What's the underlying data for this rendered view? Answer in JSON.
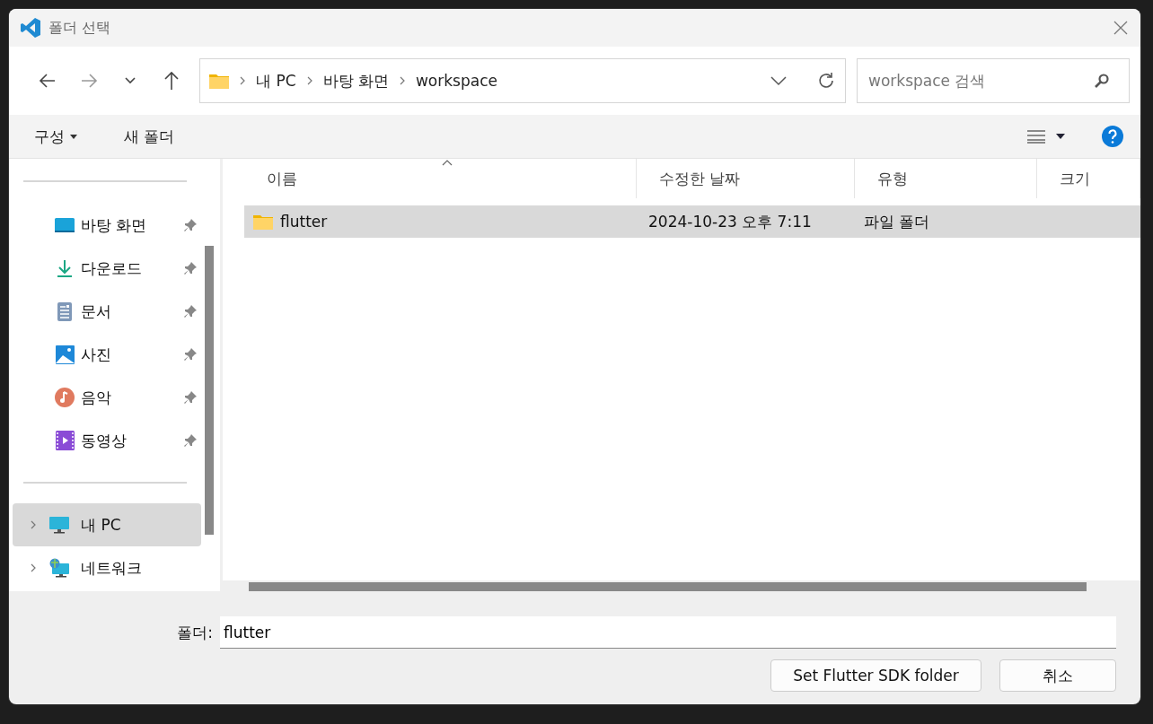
{
  "window": {
    "title": "폴더 선택"
  },
  "address_bar": {
    "crumbs": [
      "내 PC",
      "바탕 화면",
      "workspace"
    ]
  },
  "search": {
    "placeholder": "workspace 검색"
  },
  "toolbar": {
    "organize": "구성",
    "new_folder": "새 폴더"
  },
  "sidebar": {
    "quick_access": [
      {
        "label": "바탕 화면",
        "kind": "desktop"
      },
      {
        "label": "다운로드",
        "kind": "download"
      },
      {
        "label": "문서",
        "kind": "document"
      },
      {
        "label": "사진",
        "kind": "picture"
      },
      {
        "label": "음악",
        "kind": "music"
      },
      {
        "label": "동영상",
        "kind": "video"
      }
    ],
    "locations": [
      {
        "label": "내 PC",
        "kind": "pc",
        "selected": true
      },
      {
        "label": "네트워크",
        "kind": "network",
        "selected": false
      }
    ]
  },
  "table": {
    "columns": [
      "이름",
      "수정한 날짜",
      "유형",
      "크기"
    ],
    "rows": [
      {
        "name": "flutter",
        "modified": "2024-10-23 오후 7:11",
        "type": "파일 폴더",
        "selected": true
      }
    ]
  },
  "folder_field": {
    "label": "폴더:",
    "value": "flutter"
  },
  "buttons": [
    "Set Flutter SDK folder",
    "취소"
  ]
}
